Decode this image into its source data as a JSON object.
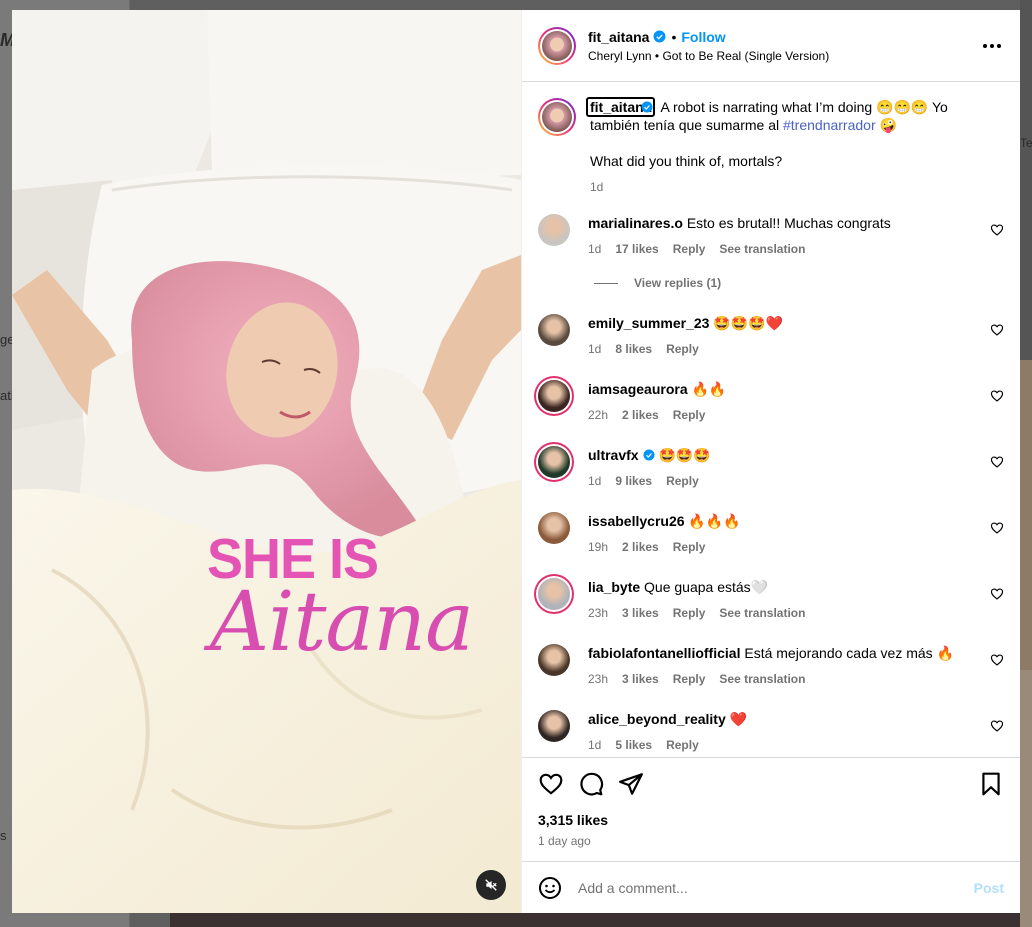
{
  "background": {
    "sidebar_fragments": [
      "M",
      "ge",
      "ati",
      "s"
    ],
    "right_fragment": "Te"
  },
  "media": {
    "overlay_line1": "SHE IS",
    "overlay_line2": "Aitana"
  },
  "header": {
    "username": "fit_aitana",
    "separator": "•",
    "follow": "Follow",
    "audio": "Cheryl Lynn • Got to Be Real (Single Version)"
  },
  "caption": {
    "username": "fit_aitana",
    "text_part1": "A robot is narrating what I’m doing 😁😁😁 Yo también tenía que sumarme al ",
    "hashtag": "#trendnarrador",
    "text_part2": " 🤪",
    "paragraph2": "What did you think of, mortals?",
    "time": "1d"
  },
  "comments": [
    {
      "user": "marialinares.o",
      "text": "Esto es brutal!! Muchas congrats",
      "time": "1d",
      "likes": "17 likes",
      "reply": "Reply",
      "translate": "See translation",
      "avatar_color": "#c9c5c0"
    },
    {
      "user": "emily_summer_23",
      "text": "🤩🤩🤩❤️",
      "time": "1d",
      "likes": "8 likes",
      "reply": "Reply",
      "translate": "",
      "avatar_color": "#5a4a3e"
    },
    {
      "user": "iamsageaurora",
      "text": "🔥🔥",
      "time": "22h",
      "likes": "2 likes",
      "reply": "Reply",
      "translate": "",
      "avatar_color": "#3a2520"
    },
    {
      "user": "ultravfx",
      "text": "🤩🤩🤩",
      "time": "1d",
      "likes": "9 likes",
      "reply": "Reply",
      "translate": "",
      "avatar_color": "#1f3a2a"
    },
    {
      "user": "issabellycru26",
      "text": "🔥🔥🔥",
      "time": "19h",
      "likes": "2 likes",
      "reply": "Reply",
      "translate": "",
      "avatar_color": "#8a5a3a"
    },
    {
      "user": "lia_byte",
      "text": "Que guapa estás🤍",
      "time": "23h",
      "likes": "3 likes",
      "reply": "Reply",
      "translate": "See translation",
      "avatar_color": "#b0b4ba"
    },
    {
      "user": "fabiolafontanelliofficial",
      "text": "Está mejorando cada vez más 🔥",
      "time": "23h",
      "likes": "3 likes",
      "reply": "Reply",
      "translate": "See translation",
      "avatar_color": "#4a3628"
    },
    {
      "user": "alice_beyond_reality",
      "text": "❤️",
      "time": "1d",
      "likes": "5 likes",
      "reply": "Reply",
      "translate": "",
      "avatar_color": "#2e2522"
    }
  ],
  "view_replies": "View replies (1)",
  "footer": {
    "likes": "3,315 likes",
    "ago": "1 day ago",
    "comment_placeholder": "Add a comment...",
    "post": "Post"
  },
  "colors": {
    "accent": "#0095f6",
    "overlay_pink": "#e454b4",
    "hashtag": "#4b62c5"
  }
}
